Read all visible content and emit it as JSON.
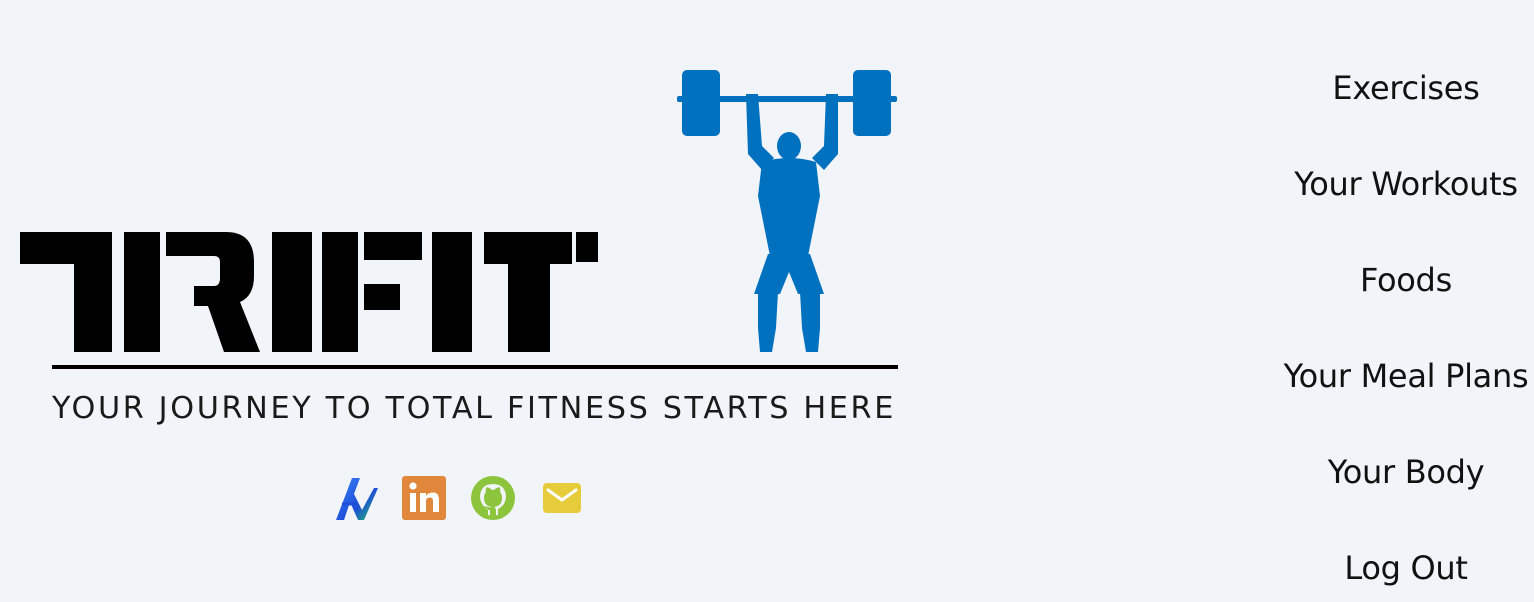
{
  "brand": {
    "name": "TRIFIT",
    "tagline": "YOUR JOURNEY TO TOTAL FITNESS STARTS HERE",
    "accent_color": "#0071bf",
    "text_color": "#000000"
  },
  "socials": [
    {
      "name": "portfolio",
      "icon": "portfolio-logo-icon"
    },
    {
      "name": "linkedin",
      "icon": "linkedin-icon",
      "label": "in",
      "color": "#e0873b"
    },
    {
      "name": "github",
      "icon": "github-icon",
      "color": "#8cc43c"
    },
    {
      "name": "email",
      "icon": "mail-icon",
      "color": "#e6cc3a"
    }
  ],
  "nav": {
    "items": [
      {
        "label": "Exercises"
      },
      {
        "label": "Your Workouts"
      },
      {
        "label": "Foods"
      },
      {
        "label": "Your Meal Plans"
      },
      {
        "label": "Your Body"
      },
      {
        "label": "Log Out"
      }
    ]
  },
  "colors": {
    "background": "#f1f4f9"
  }
}
